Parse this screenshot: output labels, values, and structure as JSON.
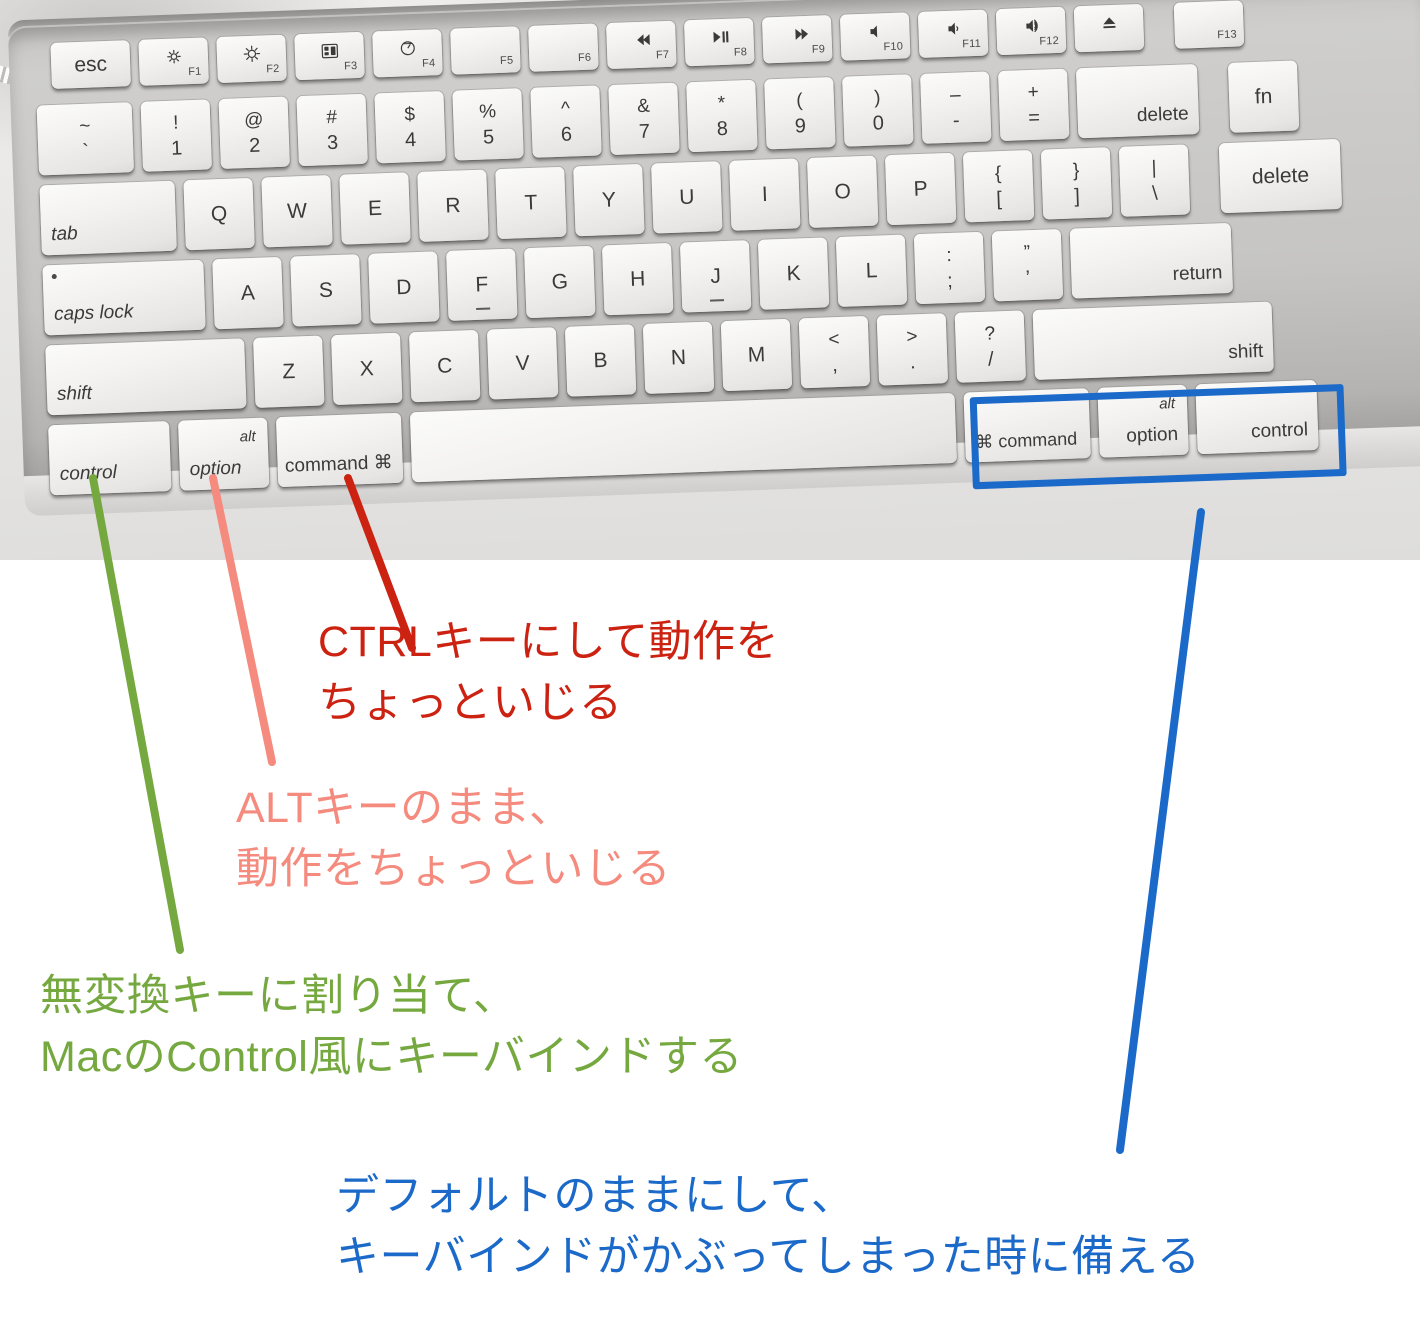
{
  "meta": {
    "colors": {
      "red": "#cc2211",
      "pink": "#f48b7e",
      "green": "#75a83f",
      "blue": "#1b69c8"
    }
  },
  "photo": {
    "description": "Apple aluminum keyboard photograph, black and white"
  },
  "keyboard": {
    "function_row": [
      {
        "label": "esc",
        "fn": "",
        "icon": ""
      },
      {
        "label": "",
        "fn": "F1",
        "icon": "brightness-down-icon"
      },
      {
        "label": "",
        "fn": "F2",
        "icon": "brightness-up-icon"
      },
      {
        "label": "",
        "fn": "F3",
        "icon": "mission-control-icon"
      },
      {
        "label": "",
        "fn": "F4",
        "icon": "dashboard-icon"
      },
      {
        "label": "",
        "fn": "F5",
        "icon": ""
      },
      {
        "label": "",
        "fn": "F6",
        "icon": ""
      },
      {
        "label": "",
        "fn": "F7",
        "icon": "rewind-icon"
      },
      {
        "label": "",
        "fn": "F8",
        "icon": "play-pause-icon"
      },
      {
        "label": "",
        "fn": "F9",
        "icon": "fast-forward-icon"
      },
      {
        "label": "",
        "fn": "F10",
        "icon": "mute-icon"
      },
      {
        "label": "",
        "fn": "F11",
        "icon": "volume-down-icon"
      },
      {
        "label": "",
        "fn": "F12",
        "icon": "volume-up-icon"
      },
      {
        "label": "",
        "fn": "",
        "icon": "eject-icon"
      },
      {
        "label": "",
        "fn": "F13",
        "icon": ""
      }
    ],
    "number_row": [
      {
        "top": "~",
        "bottom": "`"
      },
      {
        "top": "!",
        "bottom": "1"
      },
      {
        "top": "@",
        "bottom": "2"
      },
      {
        "top": "#",
        "bottom": "3"
      },
      {
        "top": "$",
        "bottom": "4"
      },
      {
        "top": "%",
        "bottom": "5"
      },
      {
        "top": "^",
        "bottom": "6"
      },
      {
        "top": "&",
        "bottom": "7"
      },
      {
        "top": "*",
        "bottom": "8"
      },
      {
        "top": "(",
        "bottom": "9"
      },
      {
        "top": ")",
        "bottom": "0"
      },
      {
        "top": "–",
        "bottom": "-"
      },
      {
        "top": "+",
        "bottom": "="
      }
    ],
    "number_row_right": [
      {
        "label": "delete"
      },
      {
        "label": "fn"
      }
    ],
    "tab_row": {
      "tab_label": "tab",
      "keys": [
        "Q",
        "W",
        "E",
        "R",
        "T",
        "Y",
        "U",
        "I",
        "O",
        "P"
      ],
      "bracket_keys": [
        {
          "top": "{",
          "bottom": "["
        },
        {
          "top": "}",
          "bottom": "]"
        },
        {
          "top": "|",
          "bottom": "\\"
        }
      ],
      "right_label": "delete"
    },
    "home_row": {
      "caps_label": "caps lock",
      "keys": [
        "A",
        "S",
        "D",
        "F",
        "G",
        "H",
        "J",
        "K",
        "L"
      ],
      "punct_keys": [
        {
          "top": ":",
          "bottom": ";"
        },
        {
          "top": "”",
          "bottom": "’"
        }
      ],
      "return_label": "return"
    },
    "shift_row": {
      "shift_left_label": "shift",
      "keys": [
        "Z",
        "X",
        "C",
        "V",
        "B",
        "N",
        "M"
      ],
      "punct_keys": [
        {
          "top": "<",
          "bottom": ","
        },
        {
          "top": ">",
          "bottom": "."
        },
        {
          "top": "?",
          "bottom": "/"
        }
      ],
      "shift_right_label": "shift"
    },
    "bottom_row": {
      "control_left": "control",
      "option_left_top": "alt",
      "option_left_bottom": "option",
      "command_left": "command",
      "command_glyph": "⌘",
      "space": "",
      "command_right": "command",
      "option_right_top": "alt",
      "option_right_bottom": "option",
      "control_right": "control"
    }
  },
  "annotations": {
    "red": {
      "text": "CTRLキーにして動作を\nちょっといじる",
      "target": "command-key-left",
      "color": "#cc2211"
    },
    "pink": {
      "text": "ALTキーのまま、\n動作をちょっといじる",
      "target": "option-key-left",
      "color": "#f48b7e"
    },
    "green": {
      "text": "無変換キーに割り当て、\nMacのControl風にキーバインドする",
      "target": "control-key-left",
      "color": "#75a83f"
    },
    "blue": {
      "text": "デフォルトのままにして、\nキーバインドがかぶってしまった時に備える",
      "target": "right-modifier-group",
      "color": "#1b69c8"
    }
  }
}
